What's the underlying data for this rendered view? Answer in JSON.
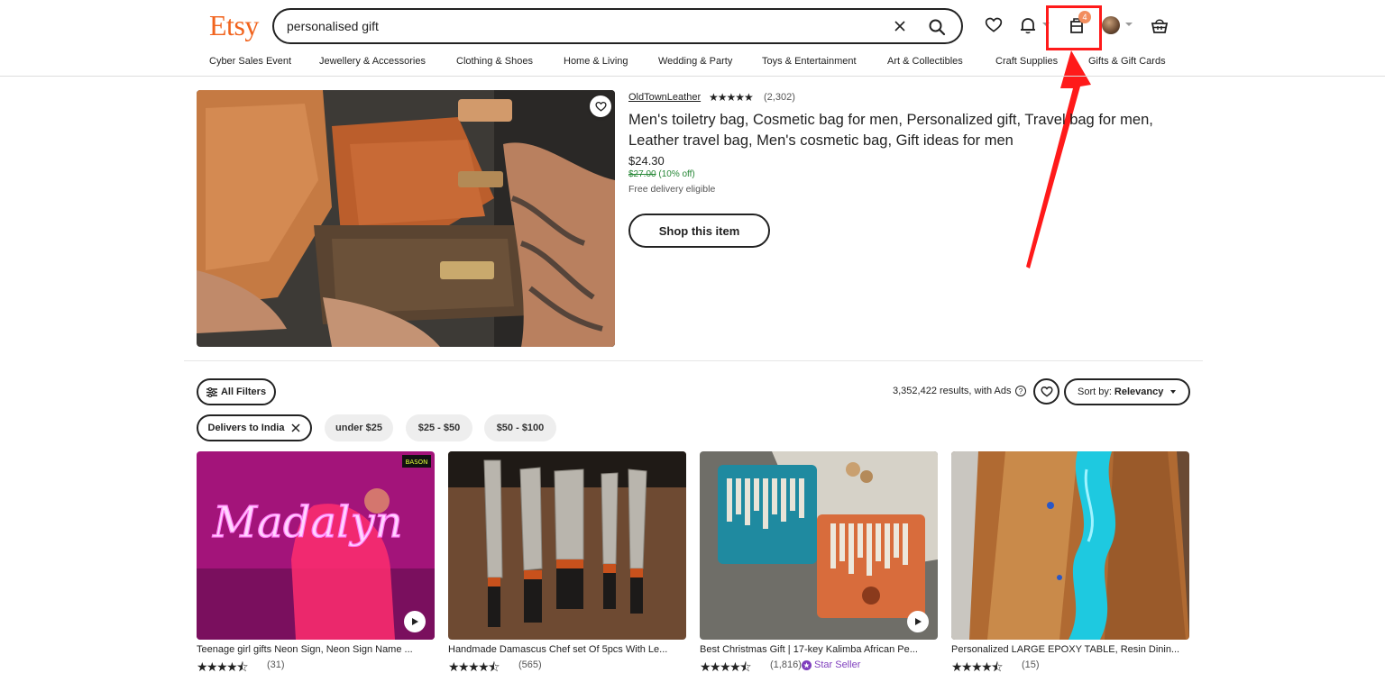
{
  "header": {
    "logo": "Etsy",
    "search_value": "personalised gift",
    "cart_count": "4"
  },
  "nav": {
    "items": [
      "Cyber Sales Event",
      "Jewellery & Accessories",
      "Clothing & Shoes",
      "Home & Living",
      "Wedding & Party",
      "Toys & Entertainment",
      "Art & Collectibles",
      "Craft Supplies",
      "Gifts & Gift Cards"
    ]
  },
  "featured": {
    "seller": "OldTownLeather",
    "stars": "★★★★★",
    "reviews": "(2,302)",
    "title": "Men's toiletry bag, Cosmetic bag for men, Personalized gift, Travel bag for men, Leather travel bag, Men's cosmetic bag, Gift ideas for men",
    "price": "$24.30",
    "original_price": "$27.00",
    "discount": "(10% off)",
    "delivery": "Free delivery eligible",
    "button": "Shop this item"
  },
  "filters": {
    "all_filters": "All Filters",
    "results": "3,352,422 results, with Ads",
    "sort_label": "Sort by:",
    "sort_value": "Relevancy",
    "chips": [
      "Delivers to India",
      "under $25",
      "$25 - $50",
      "$50 - $100"
    ]
  },
  "listings": [
    {
      "title": "Teenage girl gifts Neon Sign, Neon Sign Name ...",
      "stars": "★★★★⯪",
      "reviews": "(31)",
      "image_text": "Madalyn",
      "brand_tag": "BASON",
      "star_seller": ""
    },
    {
      "title": "Handmade Damascus Chef set Of 5pcs With Le...",
      "stars": "★★★★⯪",
      "reviews": "(565)",
      "star_seller": ""
    },
    {
      "title": "Best Christmas Gift | 17-key Kalimba African Pe...",
      "stars": "★★★★⯪",
      "reviews": "(1,816)",
      "star_seller": "Star Seller"
    },
    {
      "title": "Personalized LARGE EPOXY TABLE, Resin Dinin...",
      "stars": "★★★★⯪",
      "reviews": "(15)",
      "star_seller": ""
    }
  ],
  "colors": {
    "brand": "#f1641e",
    "highlight": "#ff1a1a",
    "discount_green": "#258635",
    "star_seller_purple": "#7f3ebd"
  }
}
